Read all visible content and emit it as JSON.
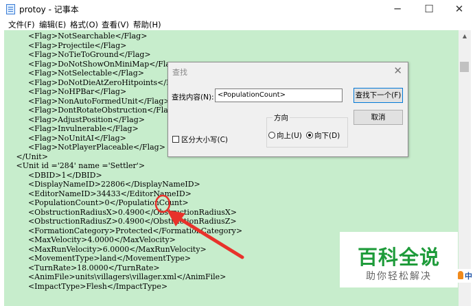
{
  "window": {
    "title": "protoy - 记事本",
    "minimize_glyph": "─",
    "maximize_glyph": "☐",
    "close_glyph": "✕"
  },
  "menu": [
    "文件(F)",
    "编辑(E)",
    "格式(O)",
    "查看(V)",
    "帮助(H)"
  ],
  "editor": {
    "lines": [
      "          <Flag>NotSearchable</Flag>",
      "          <Flag>Projectile</Flag>",
      "          <Flag>NoTieToGround</Flag>",
      "          <Flag>DoNotShowOnMiniMap</Flag>",
      "          <Flag>NotSelectable</Flag>",
      "          <Flag>DoNotDieAtZeroHitpoints</Flag>",
      "          <Flag>NoHPBar</Flag>",
      "          <Flag>NonAutoFormedUnit</Flag>",
      "          <Flag>DontRotateObstruction</Flag>",
      "          <Flag>AdjustPosition</Flag>",
      "          <Flag>Invulnerable</Flag>",
      "          <Flag>NoUnitAI</Flag>",
      "          <Flag>NotPlayerPlaceable</Flag>",
      "     </Unit>",
      "     <Unit id ='284' name ='Settler'>",
      "          <DBID>1</DBID>",
      "          <DisplayNameID>22806</DisplayNameID>",
      "          <EditorNameID>34433</EditorNameID>",
      "          <PopulationCount>0</PopulationCount>",
      "          <ObstructionRadiusX>0.4900</ObstructionRadiusX>",
      "          <ObstructionRadiusZ>0.4900</ObstructionRadiusZ>",
      "          <FormationCategory>Protected</FormationCategory>",
      "          <MaxVelocity>4.0000</MaxVelocity>",
      "          <MaxRunVelocity>6.0000</MaxRunVelocity>",
      "          <MovementType>land</MovementType>",
      "          <TurnRate>18.0000</TurnRate>",
      "          <AnimFile>units\\villagers\\villager.xml</AnimFile>",
      "          <ImpactType>Flesh</ImpactType>"
    ]
  },
  "find_dialog": {
    "title": "查找",
    "close_glyph": "✕",
    "find_label": "查找内容(N):",
    "find_value": "<PopulationCount>",
    "find_next_label": "查找下一个(F)",
    "cancel_label": "取消",
    "direction_label": "方向",
    "up_label": "向上(U)",
    "down_label": "向下(D)",
    "direction_selected": "down",
    "match_case_label": "区分大小写(C)",
    "match_case_checked": false
  },
  "watermark": {
    "main": "百科全说",
    "sub": "助你轻松解决"
  },
  "ime": "中",
  "colors": {
    "editor_bg": "#c7edcc",
    "annotation": "#e8322b",
    "watermark_green": "#1e9b3a"
  }
}
